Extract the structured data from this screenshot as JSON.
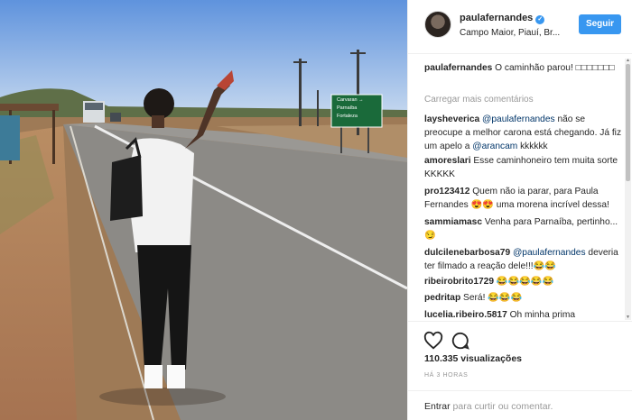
{
  "post": {
    "username": "paulafernandes",
    "location": "Campo Maior, Piauí, Br...",
    "follow_label": "Seguir",
    "verified_glyph": "✓"
  },
  "road_sign": {
    "top": "Carvaran →",
    "mid": "Parnaíba",
    "bottom": "Fortaleza"
  },
  "caption": {
    "user": "paulafernandes",
    "text": "O caminhão parou! □□□□□□□"
  },
  "load_more": "Carregar mais comentários",
  "comments": [
    {
      "user": "laysheverica",
      "mention": "@paulafernandes",
      "text": "não se preocupe a melhor carona está chegando. Já fiz um apelo a",
      "mention2": "@arancam",
      "text2": "kkkkkk"
    },
    {
      "user": "amoreslari",
      "text": "Esse caminhoneiro tem muita sorte KKKKK"
    },
    {
      "user": "pro123412",
      "text": "Quem não ia parar, para Paula Fernandes 😍😍 uma morena incrível dessa!"
    },
    {
      "user": "sammiamasc",
      "text": "Venha para Parnaíba, pertinho... 😏"
    },
    {
      "user": "dulcilenebarbosa79",
      "mention": "@paulafernandes",
      "text": "deveria ter filmado a reação dele!!!😂😂"
    },
    {
      "user": "ribeirobrito1729",
      "text": "😂😂😂😂😂"
    },
    {
      "user": "pedritap",
      "text": "Será! 😂😂😂"
    },
    {
      "user": "lucelia.ribeiro.5817",
      "text": "Oh minha prima"
    }
  ],
  "stats": {
    "views": "110.335 visualizações",
    "time": "HÁ 3 HORAS"
  },
  "add_comment": {
    "link": "Entrar",
    "text": "para curtir ou comentar."
  },
  "icons": [
    "heart-icon",
    "comment-icon"
  ],
  "colors": {
    "accent": "#3897f0",
    "text": "#262626",
    "muted": "#999999",
    "mention": "#003569"
  }
}
